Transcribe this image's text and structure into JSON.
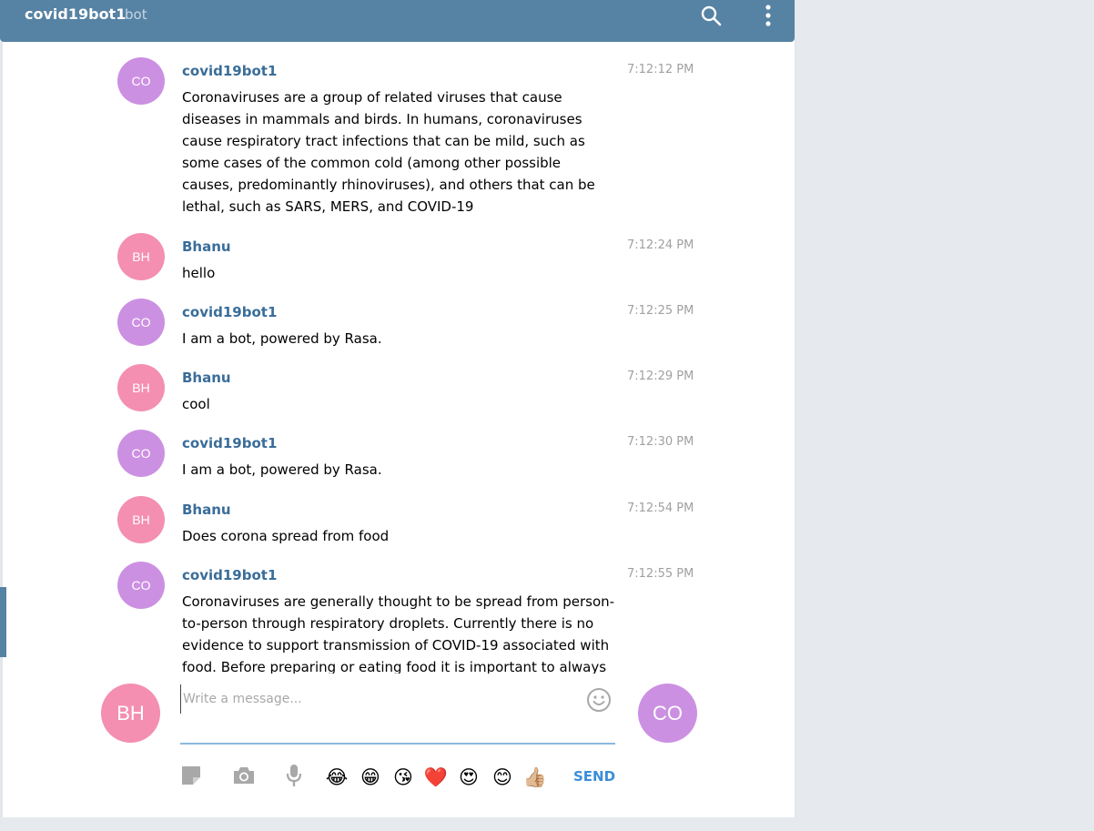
{
  "header": {
    "title": "covid19bot1",
    "subtitle": "bot"
  },
  "messages": [
    {
      "initials": "CO",
      "author": "covid19bot1",
      "time": "7:12:12 PM",
      "text": "Coronaviruses are a group of related viruses that cause diseases in mammals and birds. In humans, coronaviruses cause respiratory tract infections that can be mild, such as some cases of the common cold (among other possible causes, predominantly rhinoviruses), and others that can be lethal, such as SARS, MERS, and COVID-19"
    },
    {
      "initials": "BH",
      "author": "Bhanu",
      "time": "7:12:24 PM",
      "text": "hello"
    },
    {
      "initials": "CO",
      "author": "covid19bot1",
      "time": "7:12:25 PM",
      "text": "I am a bot, powered by Rasa."
    },
    {
      "initials": "BH",
      "author": "Bhanu",
      "time": "7:12:29 PM",
      "text": "cool"
    },
    {
      "initials": "CO",
      "author": "covid19bot1",
      "time": "7:12:30 PM",
      "text": "I am a bot, powered by Rasa."
    },
    {
      "initials": "BH",
      "author": "Bhanu",
      "time": "7:12:54 PM",
      "text": "Does corona spread from food"
    },
    {
      "initials": "CO",
      "author": "covid19bot1",
      "time": "7:12:55 PM",
      "text": "Coronaviruses are generally thought to be spread from person-to-person through respiratory droplets. Currently there is no evidence to support transmission of COVID-19 associated with food. Before preparing or eating food it is important to always"
    }
  ],
  "composer": {
    "placeholder": "Write a message...",
    "my_initials": "BH",
    "peer_initials": "CO",
    "send_label": "SEND",
    "emojis": [
      "😂",
      "😁",
      "😘",
      "❤️",
      "😍",
      "😊",
      "👍🏼"
    ]
  },
  "colors": {
    "header": "#5682a3",
    "author": "#3a6d99",
    "bot_avatar": "#cc90e2",
    "user_avatar": "#f48fb1",
    "send": "#3b8ed8"
  }
}
